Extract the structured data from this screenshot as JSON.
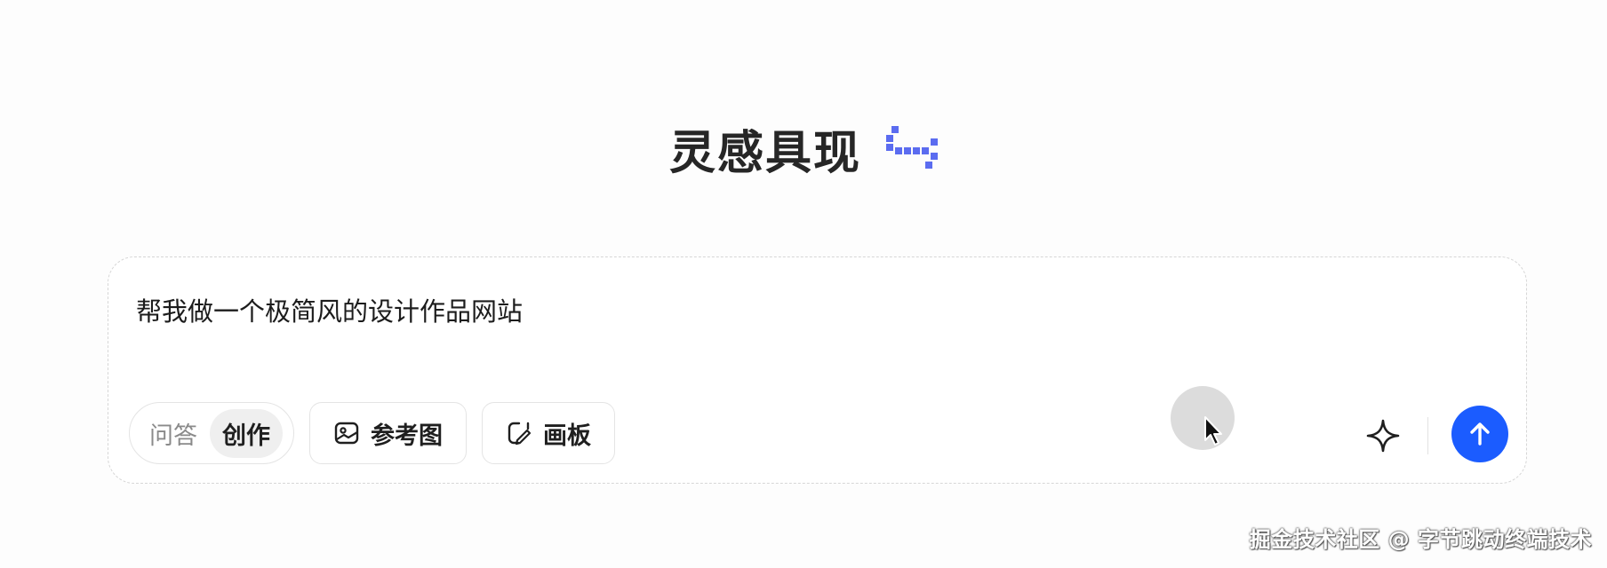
{
  "header": {
    "title": "灵感具现",
    "logo_icon": "pixel-logo-icon",
    "logo_color": "#5b6cf0"
  },
  "composer": {
    "prompt_text": "帮我做一个极简风的设计作品网站",
    "mode_options": [
      {
        "label": "问答",
        "active": false
      },
      {
        "label": "创作",
        "active": true
      }
    ],
    "reference_image_label": "参考图",
    "reference_image_icon": "image-icon",
    "canvas_label": "画板",
    "canvas_icon": "canvas-pen-icon",
    "sparkle_icon": "sparkle-icon",
    "send_icon": "arrow-up-icon",
    "send_color": "#1b5cff"
  },
  "footer": {
    "watermark": "掘金技术社区 @ 字节跳动终端技术"
  }
}
